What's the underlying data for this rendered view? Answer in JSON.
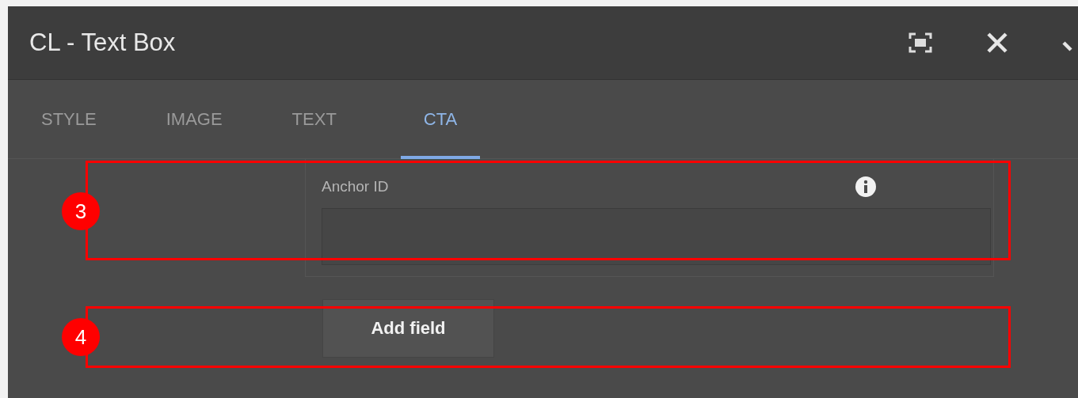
{
  "window": {
    "title": "CL - Text Box"
  },
  "tabs": [
    {
      "label": "STYLE",
      "selected": false
    },
    {
      "label": "IMAGE",
      "selected": false
    },
    {
      "label": "TEXT",
      "selected": false
    },
    {
      "label": "CTA",
      "selected": true
    }
  ],
  "fields": [
    {
      "label": "Anchor ID"
    }
  ],
  "add_button": "Add field",
  "annotations": [
    {
      "number": "3",
      "kind": "field"
    },
    {
      "number": "4",
      "kind": "button"
    }
  ]
}
